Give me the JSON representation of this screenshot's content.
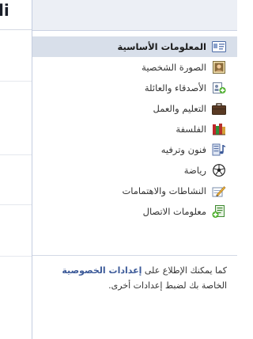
{
  "main": {
    "heading_fragment": "li"
  },
  "sidebar": {
    "items": [
      {
        "label": "المعلومات الأساسية",
        "icon": "id-card-icon",
        "active": true
      },
      {
        "label": "الصورة الشخصية",
        "icon": "profile-picture-icon",
        "active": false
      },
      {
        "label": "الأصدقاء والعائلة",
        "icon": "friends-family-icon",
        "active": false
      },
      {
        "label": "التعليم والعمل",
        "icon": "briefcase-icon",
        "active": false
      },
      {
        "label": "الفلسفة",
        "icon": "books-icon",
        "active": false
      },
      {
        "label": "فنون وترفيه",
        "icon": "music-notes-icon",
        "active": false
      },
      {
        "label": "رياضة",
        "icon": "soccer-ball-icon",
        "active": false
      },
      {
        "label": "النشاطات والاهتمامات",
        "icon": "pencil-note-icon",
        "active": false
      },
      {
        "label": "معلومات الاتصال",
        "icon": "contact-card-icon",
        "active": false
      }
    ],
    "privacy_note": {
      "before": "كما يمكنك الإطلاع على",
      "link": "إعدادات الخصوصية",
      "after": "الخاصة بك لضبط إعدادات أخرى."
    }
  },
  "colors": {
    "accent": "#3b5998",
    "active_bg": "#d8dfea",
    "panel_bg": "#eceff5"
  }
}
